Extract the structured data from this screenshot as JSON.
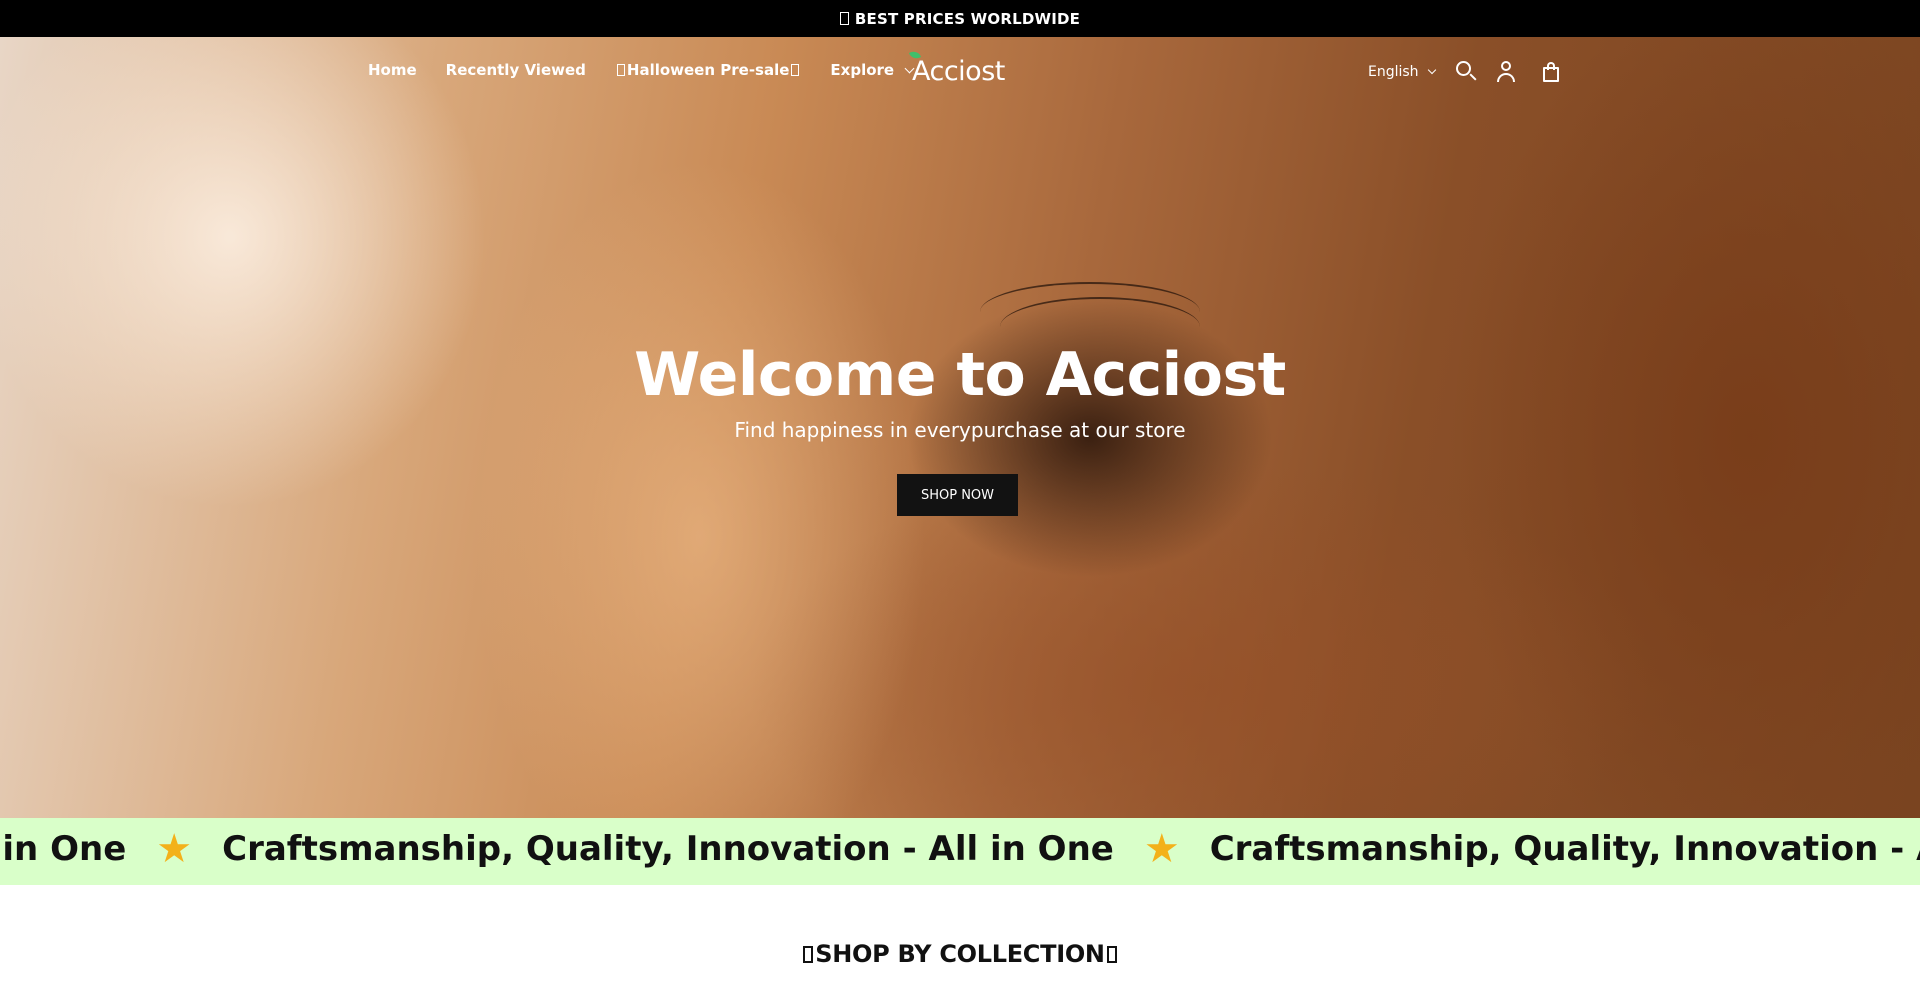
{
  "announcement": {
    "text": "BEST PRICES WORLDWIDE"
  },
  "nav": {
    "links": [
      {
        "label": "Home"
      },
      {
        "label": "Recently Viewed"
      },
      {
        "label": "Halloween Pre-sale"
      },
      {
        "label": "Explore"
      }
    ],
    "logo": "Acciost",
    "language": "English"
  },
  "icons": {
    "search": "search-icon",
    "account": "account-icon",
    "cart": "cart-icon",
    "explore_dropdown": "chevron-down-icon",
    "language_dropdown": "chevron-down-icon",
    "marquee_separator": "star-icon"
  },
  "hero": {
    "title": "Welcome to Acciost",
    "subtitle": "Find happiness in everypurchase at our store",
    "cta_label": "SHOP NOW"
  },
  "marquee": {
    "items": [
      {
        "text": "- All in One"
      },
      {
        "text": "Craftsmanship, Quality, Innovation - All in One"
      },
      {
        "text": "Craftsmanship, Quality, Innovation - All"
      }
    ],
    "separator": "★"
  },
  "section": {
    "title": "SHOP BY COLLECTION"
  },
  "colors": {
    "announcement_bg": "#000000",
    "marquee_bg": "#d9ffc9",
    "star": "#f3b11a",
    "cta_bg": "#121212"
  }
}
